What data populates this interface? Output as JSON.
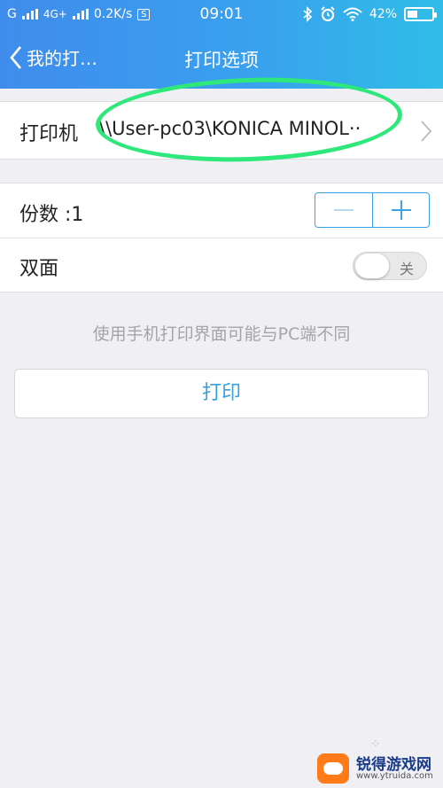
{
  "status_bar": {
    "carrier_left": "G",
    "network": "4G+",
    "speed": "0.2K/s",
    "sim_badge": "S",
    "time": "09:01",
    "battery": "42%",
    "battery_level": 0.42
  },
  "nav": {
    "back_label": "我的打…",
    "title": "打印选项"
  },
  "printer": {
    "label": "打印机",
    "value": "\\\\User-pc03\\KONICA MINOL··"
  },
  "options": {
    "copies_label": "份数 :1",
    "duplex_label": "双面",
    "duplex_toggle_label": "关",
    "duplex_on": false
  },
  "note": "使用手机打印界面可能与PC端不同",
  "print_button": "打印",
  "watermark": {
    "title": "锐得游戏网",
    "url": "www.ytruida.com"
  },
  "colors": {
    "accent": "#3aa4e6",
    "highlight": "#2fe87b",
    "header_start": "#3f8cec",
    "header_end": "#2fbde8"
  }
}
